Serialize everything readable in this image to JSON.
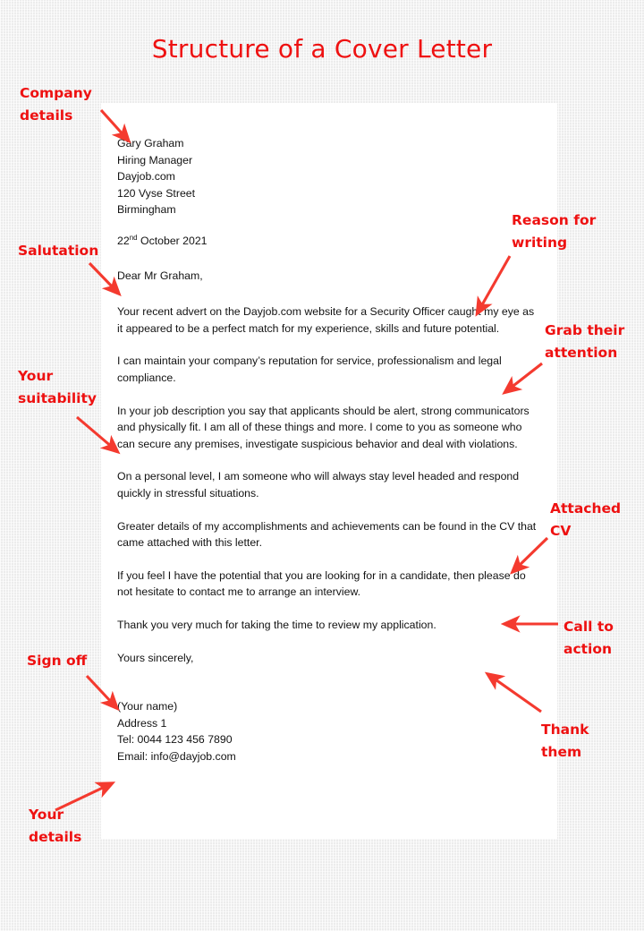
{
  "title": "Structure of a Cover Letter",
  "theme": {
    "accent_red": "#ee1111",
    "annotation_red": "#f43a2f",
    "page_background": "#ececec",
    "sheet_background": "#ffffff",
    "text_color": "#121212"
  },
  "letter": {
    "recipient": {
      "name": "Gary  Graham",
      "job_title": "Hiring Manager",
      "company": "Dayjob.com",
      "street": "120  Vyse Street",
      "city": "Birmingham"
    },
    "date": {
      "day": "22",
      "ordinal": "nd",
      "rest": " October 2021"
    },
    "salutation": "Dear Mr  Graham,",
    "paragraphs": [
      "Your recent advert on the Dayjob.com  website for a Security Officer caught  my eye as it appeared to be a perfect match  for my experience, skills and future potential.",
      "I can  maintain your company’s  reputation for service, professionalism and legal compliance.",
      "In your job description you say that  applicants should be alert, strong communicators  and physically fit. I am all of these things and more. I come to you as someone who can  secure any premises, investigate suspicious behavior and deal with violations.",
      "On a personal level, I am someone who will always stay level headed and respond quickly in stressful situations.",
      "Greater  details of my accomplishments and achievements can  be found in the CV that came attached  with this letter.",
      "If you feel I have the potential that you are looking for in a candidate, then please do not hesitate to contact  me to arrange an interview.",
      "Thank you very much  for taking the time to review my application."
    ],
    "sign_off": "Yours sincerely,",
    "sender": {
      "name": "(Your name)",
      "address": "Address 1",
      "tel": "Tel: 0044  123  456  7890",
      "email": "Email: info@dayjob.com"
    }
  },
  "annotations": {
    "company_details": "Company\ndetails",
    "salutation": "Salutation",
    "your_suitability": "Your\nsuitability",
    "sign_off": "Sign off",
    "your_details": "Your\ndetails",
    "reason_for_writing": "Reason for\nwriting",
    "grab_their_attention": "Grab their\nattention",
    "attached_cv": "Attached\nCV",
    "call_to_action": "Call to\naction",
    "thank_them": "Thank\nthem"
  }
}
